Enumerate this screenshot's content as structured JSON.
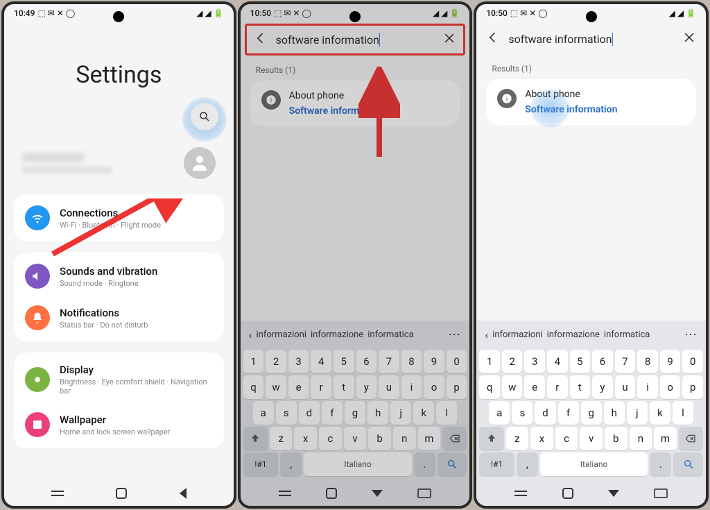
{
  "phone1": {
    "time": "10:49",
    "status_left_icons": "⬚ ✉ ✕ ◯",
    "status_right_icons": "◢ ◢ 🔋",
    "title": "Settings",
    "settings": [
      {
        "title": "Connections",
        "sub": "Wi-Fi · Bluetooth · Flight mode"
      },
      {
        "title": "Sounds and vibration",
        "sub": "Sound mode · Ringtone"
      },
      {
        "title": "Notifications",
        "sub": "Status bar · Do not disturb"
      },
      {
        "title": "Display",
        "sub": "Brightness · Eye comfort shield · Navigation bar"
      },
      {
        "title": "Wallpaper",
        "sub": "Home and lock screen wallpaper"
      }
    ]
  },
  "phone2": {
    "time": "10:50",
    "status_left_icons": "⬚ ✉ ✕ ◯",
    "search_value": "software information",
    "results_label": "Results (1)",
    "result_parent": "About phone",
    "result_match": "Software information"
  },
  "phone3": {
    "time": "10:50",
    "status_left_icons": "⬚ ✉ ✕ ◯",
    "search_value": "software information",
    "results_label": "Results (1)",
    "result_parent": "About phone",
    "result_match": "Software information"
  },
  "keyboard": {
    "predictions": [
      "informazioni",
      "informazione",
      "informatica"
    ],
    "row_num": [
      "1",
      "2",
      "3",
      "4",
      "5",
      "6",
      "7",
      "8",
      "9",
      "0"
    ],
    "row1": [
      "q",
      "w",
      "e",
      "r",
      "t",
      "y",
      "u",
      "i",
      "o",
      "p"
    ],
    "row2": [
      "a",
      "s",
      "d",
      "f",
      "g",
      "h",
      "j",
      "k",
      "l"
    ],
    "row3": [
      "z",
      "x",
      "c",
      "v",
      "b",
      "n",
      "m"
    ],
    "sym_key": "!#1",
    "space_label": "Italiano",
    "comma": ",",
    "period": "."
  }
}
